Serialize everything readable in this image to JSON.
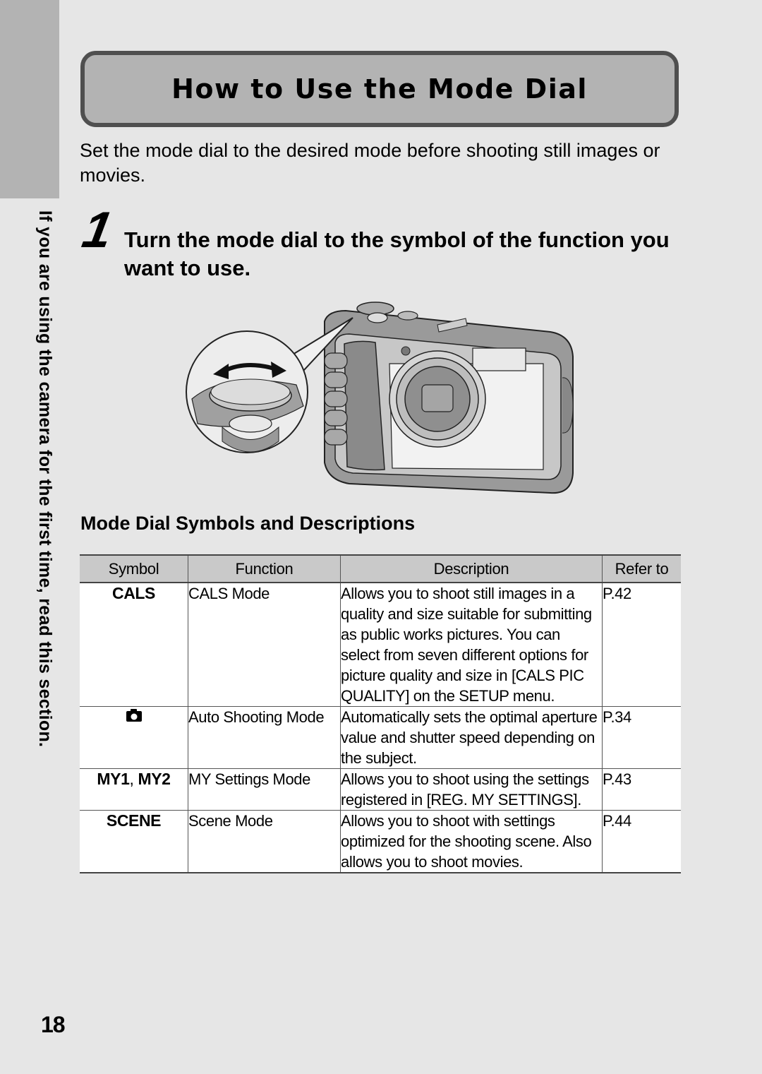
{
  "side_tab": {
    "text": "If you are using the camera for the first time, read this section."
  },
  "title": "How to Use the Mode Dial",
  "intro": "Set the mode dial to the desired mode before shooting still images or movies.",
  "step": {
    "number": "1",
    "text": "Turn the mode dial to the symbol of the function you want to use."
  },
  "illustration": {
    "icon": "camera-mode-dial-illustration",
    "arrow_icon": "double-headed-arrow"
  },
  "table": {
    "title": "Mode Dial Symbols and Descriptions",
    "headers": [
      "Symbol",
      "Function",
      "Description",
      "Refer to"
    ],
    "rows": [
      {
        "symbol": "CALS",
        "function": "CALS Mode",
        "description": "Allows you to shoot still images in a quality and size suitable for submitting as public works pictures. You can select from seven different options for picture quality and size in [CALS PIC QUALITY] on the SETUP menu.",
        "refer": "P.42"
      },
      {
        "symbol": "",
        "symbol_icon": "camera-icon",
        "function": "Auto Shooting Mode",
        "description": "Automatically sets the optimal aperture value and shutter speed depending on the subject.",
        "refer": "P.34"
      },
      {
        "symbol_a": "MY1",
        "symbol_sep": ", ",
        "symbol_b": "MY2",
        "function": "MY Settings Mode",
        "description": "Allows you to shoot using the settings registered in [REG. MY SETTINGS].",
        "refer": "P.43"
      },
      {
        "symbol": "SCENE",
        "function": "Scene Mode",
        "description": "Allows you to shoot with settings optimized for the shooting scene. Also allows you to shoot movies.",
        "refer": "P.44"
      }
    ]
  },
  "page_number": "18"
}
